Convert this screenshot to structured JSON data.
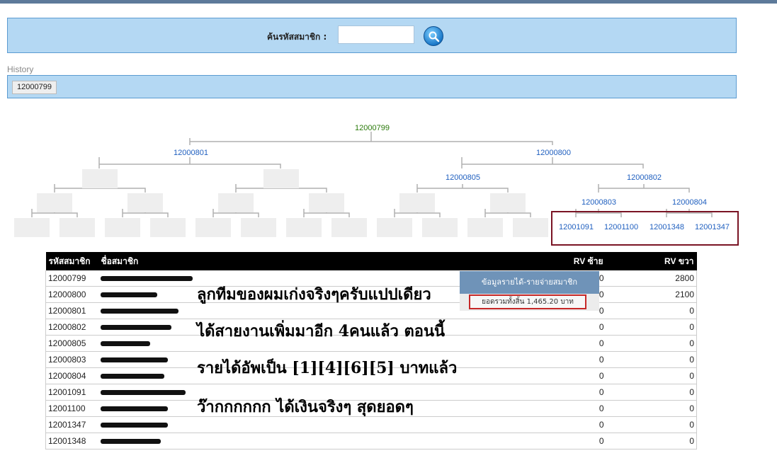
{
  "search": {
    "label": "ค้นรหัสสมาชิก :",
    "value": "",
    "placeholder": ""
  },
  "history": {
    "label": "History",
    "items": [
      "12000799"
    ]
  },
  "tree": {
    "root": "12000799",
    "level1": [
      "12000801",
      "12000800"
    ],
    "level2": [
      "12000805",
      "12000802"
    ],
    "level3": [
      "12000803",
      "12000804"
    ],
    "level4": [
      "12001091",
      "12001100",
      "12001348",
      "12001347"
    ]
  },
  "table": {
    "headers": {
      "code": "รหัสสมาชิก",
      "name": "ชื่อสมาชิก",
      "rv_left": "RV ซ้าย",
      "rv_right": "RV ขวา"
    },
    "rows": [
      {
        "code": "12000799",
        "rv_left": "0",
        "rv_right": "2800"
      },
      {
        "code": "12000800",
        "rv_left": "0",
        "rv_right": "2100"
      },
      {
        "code": "12000801",
        "rv_left": "0",
        "rv_right": "0"
      },
      {
        "code": "12000802",
        "rv_left": "0",
        "rv_right": "0"
      },
      {
        "code": "12000805",
        "rv_left": "0",
        "rv_right": "0"
      },
      {
        "code": "12000803",
        "rv_left": "0",
        "rv_right": "0"
      },
      {
        "code": "12000804",
        "rv_left": "0",
        "rv_right": "0"
      },
      {
        "code": "12001091",
        "rv_left": "0",
        "rv_right": "0"
      },
      {
        "code": "12001100",
        "rv_left": "0",
        "rv_right": "0"
      },
      {
        "code": "12001347",
        "rv_left": "0",
        "rv_right": "0"
      },
      {
        "code": "12001348",
        "rv_left": "0",
        "rv_right": "0"
      }
    ]
  },
  "popup": {
    "title": "ข้อมูลรายได้-รายจ่ายสมาชิก",
    "total": "ยอดรวมทั้งสิ้น 1,465.20 บาท"
  },
  "overlay_text": [
    "ลูกทีมของผมเก่งจริงๆครับแปปเดียว",
    "ได้สายงานเพิ่มมาอีก 4คนแล้ว ตอนนี้",
    "รายได้อัพเป็น [1][4][6][5] บาทแล้ว",
    "ว๊ากกกกกก ได้เงินจริงๆ สุดยอดๆ"
  ],
  "icons": {
    "search": "magnifier-icon"
  },
  "colors": {
    "panel": "#b4d8f3",
    "panel_border": "#5b9bd1",
    "link": "#1f5fbf",
    "root": "#2b7a0b",
    "highlight": "#7a1424"
  }
}
